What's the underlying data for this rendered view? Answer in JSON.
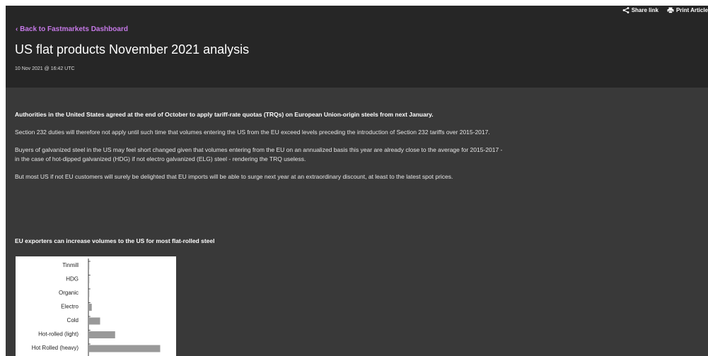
{
  "toolbar": {
    "share_label": "Share link",
    "print_label": "Print Article"
  },
  "nav": {
    "back_label": "‹ Back to Fastmarkets Dashboard"
  },
  "article": {
    "title": "US flat products November 2021 analysis",
    "timestamp": "10 Nov 2021 @ 16:42 UTC",
    "paragraphs": [
      "Authorities in the United States agreed at the end of October to apply tariff-rate quotas (TRQs) on European Union-origin steels from next January.",
      "Section 232 duties will therefore not apply until such time that volumes entering the US from the EU exceed levels preceding the introduction of Section 232 tariffs over 2015-2017.",
      "Buyers of galvanized steel in the US may feel short changed given that volumes entering from the EU on an annualized basis this year are already close to the average for 2015-2017 - in the case of hot-dipped galvanized (HDG) if not electro galvanized (ELG) steel - rendering the TRQ useless.",
      "But most US if not EU customers will surely be delighted that EU imports will be able to surge next year at an extraordinary discount, at least to the latest spot prices."
    ],
    "chart_heading": "EU exporters can increase volumes to the US for most flat-rolled steel"
  },
  "chart_data": {
    "type": "bar",
    "orientation": "horizontal",
    "categories": [
      "Tinmill",
      "HDG",
      "Organic",
      "Electro",
      "Cold",
      "Hot-rolled (light)",
      "Hot Rolled (heavy)"
    ],
    "values": [
      1,
      1,
      1,
      4,
      14,
      32,
      86
    ],
    "xlim": [
      0,
      100
    ],
    "bar_color": "#999999"
  }
}
